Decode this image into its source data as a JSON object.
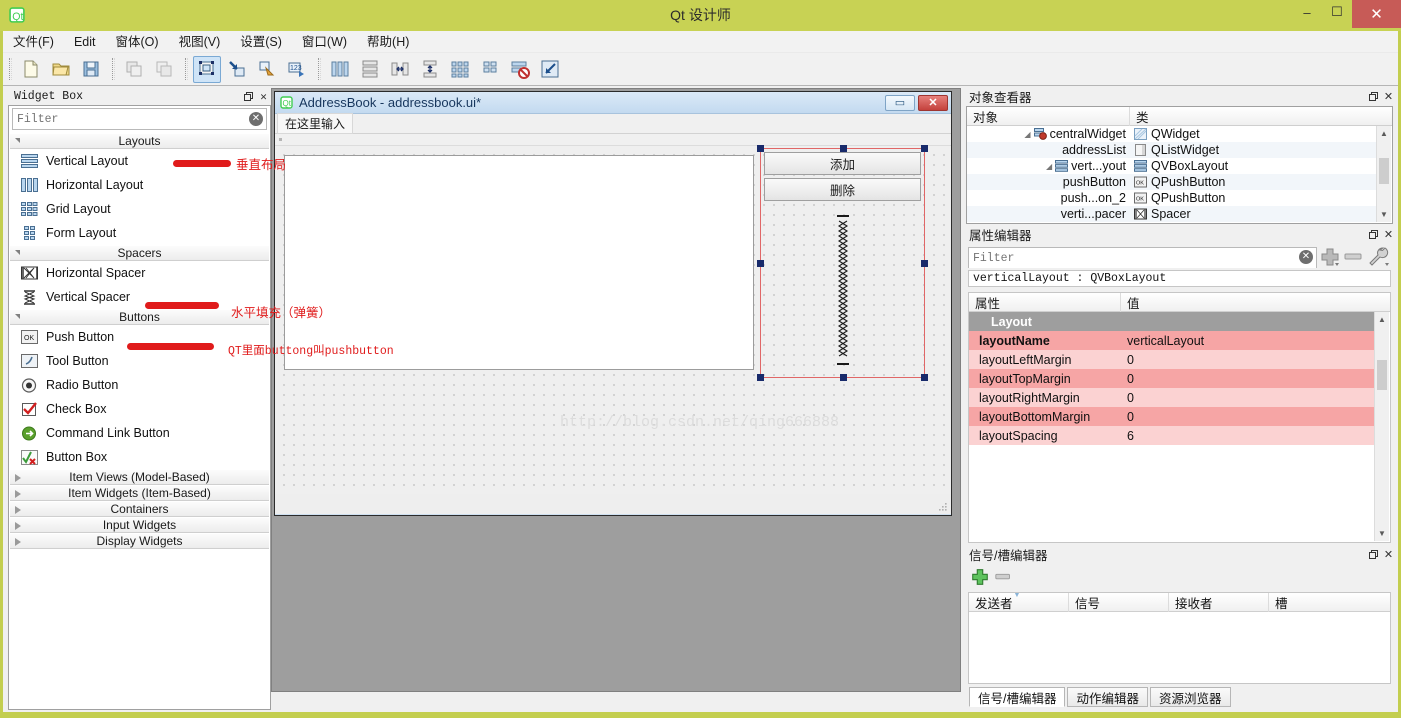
{
  "window": {
    "title": "Qt 设计师",
    "app_icon": "qt-logo-icon",
    "minimize": "–",
    "maximize": "☐",
    "close": "✕"
  },
  "menubar": {
    "items": [
      {
        "label": "文件(F)",
        "name": "menu-file"
      },
      {
        "label": "Edit",
        "name": "menu-edit"
      },
      {
        "label": "窗体(O)",
        "name": "menu-form"
      },
      {
        "label": "视图(V)",
        "name": "menu-view"
      },
      {
        "label": "设置(S)",
        "name": "menu-settings"
      },
      {
        "label": "窗口(W)",
        "name": "menu-window"
      },
      {
        "label": "帮助(H)",
        "name": "menu-help"
      }
    ]
  },
  "toolbar": {
    "groups": [
      [
        "new-file-icon",
        "open-file-icon",
        "save-file-icon"
      ],
      [
        "undo-icon",
        "redo-icon"
      ],
      [
        "edit-widgets-icon",
        "edit-signals-slots-icon",
        "edit-buddies-icon",
        "edit-tab-order-icon"
      ],
      [
        "layout-horizontally-icon",
        "layout-vertically-icon",
        "layout-in-splitter-h-icon",
        "layout-in-splitter-v-icon",
        "layout-grid-icon",
        "layout-form-icon",
        "break-layout-icon",
        "adjust-size-icon"
      ]
    ],
    "active_index": "edit-widgets-icon"
  },
  "widget_box": {
    "title": "Widget Box",
    "float_btn": "restore-icon",
    "close_btn": "close-icon",
    "filter": {
      "placeholder": "Filter",
      "value": "",
      "clear_icon": "clear-icon"
    },
    "sections": [
      {
        "name": "Layouts",
        "expanded": true,
        "items": [
          {
            "label": "Vertical Layout",
            "icon": "vertical-layout-icon"
          },
          {
            "label": "Horizontal Layout",
            "icon": "horizontal-layout-icon"
          },
          {
            "label": "Grid Layout",
            "icon": "grid-layout-icon"
          },
          {
            "label": "Form Layout",
            "icon": "form-layout-icon"
          }
        ]
      },
      {
        "name": "Spacers",
        "expanded": true,
        "items": [
          {
            "label": "Horizontal Spacer",
            "icon": "horizontal-spacer-icon"
          },
          {
            "label": "Vertical Spacer",
            "icon": "vertical-spacer-icon"
          }
        ]
      },
      {
        "name": "Buttons",
        "expanded": true,
        "items": [
          {
            "label": "Push Button",
            "icon": "push-button-icon"
          },
          {
            "label": "Tool Button",
            "icon": "tool-button-icon"
          },
          {
            "label": "Radio Button",
            "icon": "radio-button-icon"
          },
          {
            "label": "Check Box",
            "icon": "check-box-icon"
          },
          {
            "label": "Command Link Button",
            "icon": "command-link-button-icon"
          },
          {
            "label": "Button Box",
            "icon": "button-box-icon"
          }
        ]
      },
      {
        "name": "Item Views (Model-Based)",
        "expanded": false,
        "items": []
      },
      {
        "name": "Item Widgets (Item-Based)",
        "expanded": false,
        "items": []
      },
      {
        "name": "Containers",
        "expanded": false,
        "items": []
      },
      {
        "name": "Input Widgets",
        "expanded": false,
        "items": []
      },
      {
        "name": "Display Widgets",
        "expanded": false,
        "items": []
      }
    ]
  },
  "form_window": {
    "title": "AddressBook - addressbook.ui*",
    "icon": "qt-logo-icon",
    "minimize": "▭",
    "close": "✕",
    "menu_placeholder": "在这里输入",
    "buttons": [
      {
        "label": "添加",
        "object": "pushButton"
      },
      {
        "label": "删除",
        "object": "pushButton_2"
      }
    ],
    "spacer": "verticalSpacer",
    "list_widget": "addressList",
    "watermark": "http://blog.csdn.net/qing666888"
  },
  "annotations": [
    {
      "text": "垂直布局",
      "target": "Vertical Layout"
    },
    {
      "text": "水平填充（弹簧）",
      "target": "Vertical Spacer"
    },
    {
      "text": "QT里面buttong叫pushbutton",
      "target": "Push Button"
    }
  ],
  "object_inspector": {
    "title": "对象查看器",
    "float_btn": "restore-icon",
    "close_btn": "close-icon",
    "columns": [
      "对象",
      "类"
    ],
    "rows": [
      {
        "object": "centralWidget",
        "class": "QWidget",
        "depth": 1,
        "expander": "open",
        "icon": "widget-icon"
      },
      {
        "object": "addressList",
        "class": "QListWidget",
        "depth": 2,
        "expander": "none",
        "icon": "listwidget-icon"
      },
      {
        "object": "vert...yout",
        "class": "QVBoxLayout",
        "depth": 2,
        "expander": "open",
        "icon": "vbox-layout-icon"
      },
      {
        "object": "pushButton",
        "class": "QPushButton",
        "depth": 3,
        "expander": "none",
        "icon": "push-button-icon"
      },
      {
        "object": "push...on_2",
        "class": "QPushButton",
        "depth": 3,
        "expander": "none",
        "icon": "push-button-icon"
      },
      {
        "object": "verti...pacer",
        "class": "Spacer",
        "depth": 3,
        "expander": "none",
        "icon": "spacer-icon"
      }
    ]
  },
  "property_editor": {
    "title": "属性编辑器",
    "float_btn": "restore-icon",
    "close_btn": "close-icon",
    "filter": {
      "placeholder": "Filter",
      "value": "",
      "clear_icon": "clear-icon"
    },
    "add_btn": "add-icon",
    "remove_btn": "remove-icon",
    "configure_btn": "wrench-icon",
    "selected_object": "verticalLayout : QVBoxLayout",
    "columns": [
      "属性",
      "值"
    ],
    "category": "Layout",
    "rows": [
      {
        "name": "layoutName",
        "value": "verticalLayout",
        "bold": true,
        "shade": "a"
      },
      {
        "name": "layoutLeftMargin",
        "value": "0",
        "bold": false,
        "shade": "b"
      },
      {
        "name": "layoutTopMargin",
        "value": "0",
        "bold": false,
        "shade": "a"
      },
      {
        "name": "layoutRightMargin",
        "value": "0",
        "bold": false,
        "shade": "b"
      },
      {
        "name": "layoutBottomMargin",
        "value": "0",
        "bold": false,
        "shade": "a"
      },
      {
        "name": "layoutSpacing",
        "value": "6",
        "bold": false,
        "shade": "b"
      }
    ]
  },
  "signal_slot_editor": {
    "title": "信号/槽编辑器",
    "float_btn": "restore-icon",
    "close_btn": "close-icon",
    "add_btn": "add-icon",
    "remove_btn": "remove-icon",
    "columns": [
      "发送者",
      "信号",
      "接收者",
      "槽"
    ],
    "rows": [],
    "tabs": [
      {
        "label": "信号/槽编辑器",
        "selected": true
      },
      {
        "label": "动作编辑器",
        "selected": false
      },
      {
        "label": "资源浏览器",
        "selected": false
      }
    ]
  },
  "colors": {
    "titlebar": "#c8d254",
    "close_button": "#c75b57",
    "annotation_red": "#e01b1b",
    "property_pink_dark": "#f6a5a5",
    "property_pink_light": "#fbd2d2",
    "selection_handle": "#182a6b",
    "mdi_background": "#9e9e9e"
  }
}
